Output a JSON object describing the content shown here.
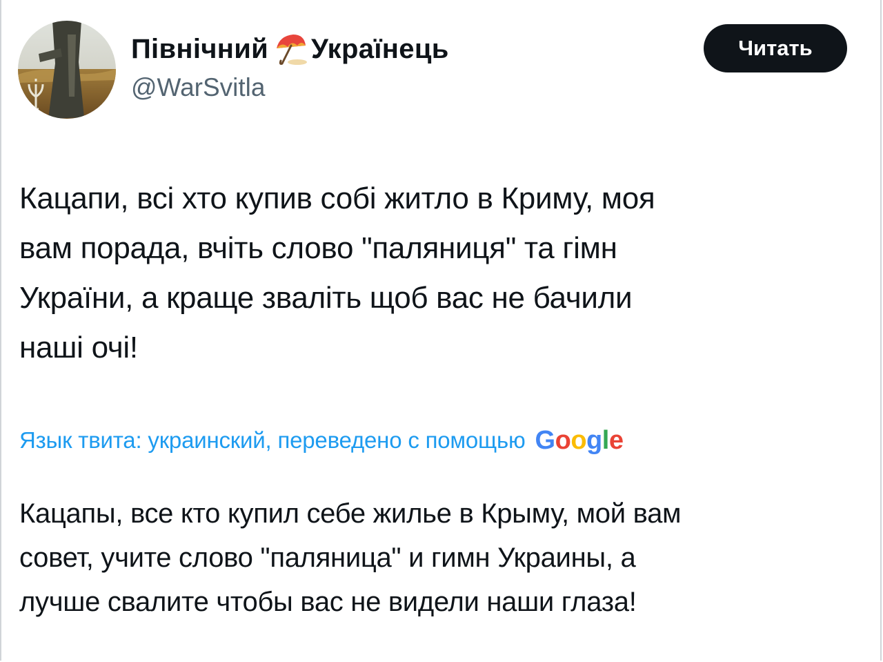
{
  "author": {
    "display_name_part1": "Північний",
    "display_name_part2": "Українець",
    "name_emoji_icon": "umbrella-icon",
    "handle": "@WarSvitla"
  },
  "actions": {
    "read_label": "Читать"
  },
  "tweet": {
    "lines": [
      "Кацапи, всі хто купив собі житло в Криму, моя",
      "вам порада, вчіть слово \"паляниця\" та гімн",
      "України, а краще зваліть щоб вас не бачили",
      "наші очі!"
    ]
  },
  "translation": {
    "label": "Язык твита: украинский, переведено с помощью",
    "provider_letters": [
      "G",
      "o",
      "o",
      "g",
      "l",
      "e"
    ],
    "provider_colors": [
      "#4285F4",
      "#EA4335",
      "#FBBC05",
      "#4285F4",
      "#34A853",
      "#EA4335"
    ],
    "lines": [
      "Кацапы, все кто купил себе жилье в Крыму, мой вам",
      "совет, учите слово \"паляница\" и гимн Украины, а",
      "лучше свалите чтобы вас не видели наши глаза!"
    ]
  },
  "colors": {
    "link_blue": "#1d9bf0",
    "text_primary": "#0f1419",
    "text_secondary": "#536471",
    "button_bg": "#0f1419"
  }
}
